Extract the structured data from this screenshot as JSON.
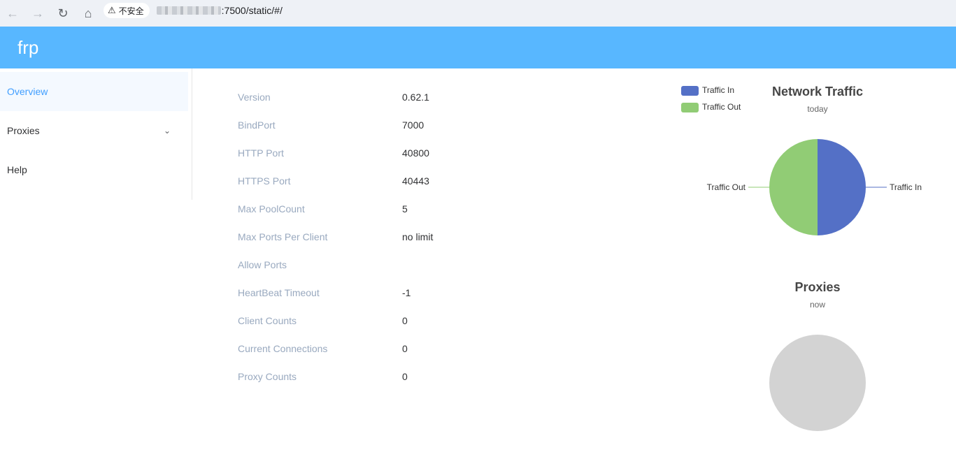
{
  "browser": {
    "security_label": "不安全",
    "url_visible": ":7500/static/#/"
  },
  "header": {
    "brand": "frp"
  },
  "sidebar": {
    "items": [
      {
        "label": "Overview",
        "active": true
      },
      {
        "label": "Proxies",
        "expandable": true
      },
      {
        "label": "Help"
      }
    ]
  },
  "overview": {
    "rows": [
      {
        "key": "Version",
        "value": "0.62.1"
      },
      {
        "key": "BindPort",
        "value": "7000"
      },
      {
        "key": "HTTP Port",
        "value": "40800"
      },
      {
        "key": "HTTPS Port",
        "value": "40443"
      },
      {
        "key": "Max PoolCount",
        "value": "5"
      },
      {
        "key": "Max Ports Per Client",
        "value": "no limit"
      },
      {
        "key": "Allow Ports",
        "value": ""
      },
      {
        "key": "HeartBeat Timeout",
        "value": "-1"
      },
      {
        "key": "Client Counts",
        "value": "0"
      },
      {
        "key": "Current Connections",
        "value": "0"
      },
      {
        "key": "Proxy Counts",
        "value": "0"
      }
    ]
  },
  "chart_data": [
    {
      "type": "pie",
      "title": "Network Traffic",
      "subtitle": "today",
      "legend": [
        "Traffic In",
        "Traffic Out"
      ],
      "legend_position": "top-left",
      "slices": [
        {
          "label": "Traffic In",
          "value": 50,
          "color": "#5470c6"
        },
        {
          "label": "Traffic Out",
          "value": 50,
          "color": "#91cc75"
        }
      ]
    },
    {
      "type": "pie",
      "title": "Proxies",
      "subtitle": "now",
      "slices": [],
      "empty_color": "#d3d3d3"
    }
  ],
  "colors": {
    "header_bg": "#58b7ff",
    "active_menu": "#409eff",
    "key_text": "#99a9bf"
  }
}
